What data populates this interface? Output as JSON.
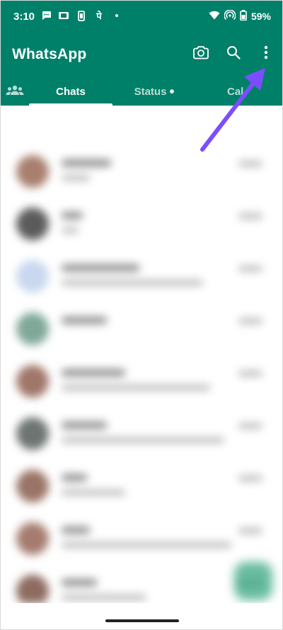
{
  "status_bar": {
    "time": "3:10",
    "left_icons": [
      "chat-bubble-icon",
      "sim-icon",
      "phone-battery-icon",
      "hindi-letter-icon",
      "dot-icon"
    ],
    "hindi_glyph": "पे",
    "right_icons": [
      "wifi-icon",
      "hotspot-icon",
      "battery-icon"
    ],
    "battery": "59%"
  },
  "app_bar": {
    "title": "WhatsApp",
    "actions": [
      "camera-icon",
      "search-icon",
      "more-options-icon"
    ]
  },
  "tabs": [
    {
      "label": "",
      "icon": "communities-icon"
    },
    {
      "label": "Chats",
      "active": true
    },
    {
      "label": "Status",
      "has_dot": true
    },
    {
      "label": "Cal"
    }
  ],
  "colors": {
    "header_green": "#008069",
    "annotation_arrow": "#7c4dff",
    "fab_green": "#35a57f"
  }
}
